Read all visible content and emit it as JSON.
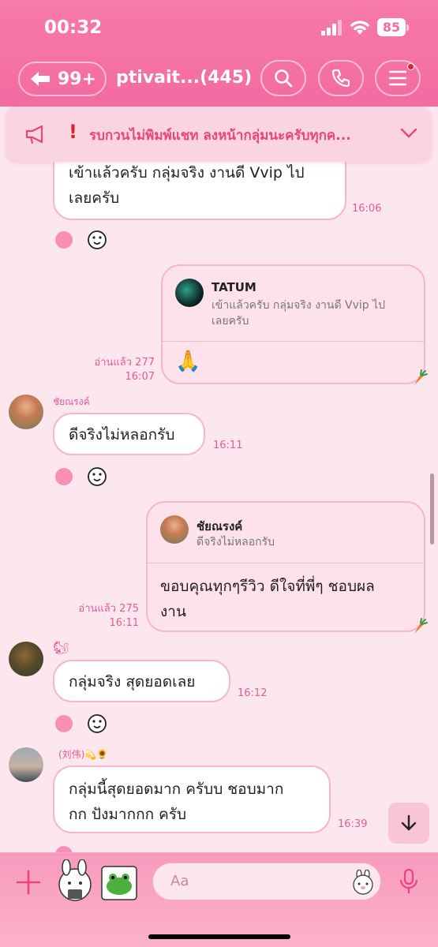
{
  "status_bar": {
    "time": "00:32",
    "battery": "85"
  },
  "header": {
    "unread_count": "99+",
    "chat_title": "ptivait...(445)"
  },
  "announcement": {
    "text": "รบกวนไม่พิมพ์แชท ลงหน้ากลุ่มนะครับทุกค..."
  },
  "messages": [
    {
      "type": "incoming",
      "text_lines": [
        "เข้าแล้วครับ กลุ่มจริง งานดี Vvip ไป",
        "เลยครับ"
      ],
      "time": "16:06"
    },
    {
      "type": "outgoing_reply",
      "quote_name": "TATUM",
      "quote_lines": [
        "เข้าแล้วครับ กลุ่มจริง งานดี Vvip ไป",
        "เลยครับ"
      ],
      "text": "🙏",
      "read": "อ่านแล้ว 277",
      "time": "16:07"
    },
    {
      "type": "incoming",
      "sender": "ชัยณรงค์",
      "text_lines": [
        "ดีจริงไม่หลอกรับ"
      ],
      "time": "16:11"
    },
    {
      "type": "outgoing_reply",
      "quote_name": "ชัยณรงค์",
      "quote_lines": [
        "ดีจริงไม่หลอกรับ"
      ],
      "text_lines": [
        "ขอบคุณทุกๆรีวิว ดีใจที่พี่ๆ ชอบผล",
        "งาน"
      ],
      "read": "อ่านแล้ว 275",
      "time": "16:11"
    },
    {
      "type": "incoming",
      "sender": "🐿",
      "text_lines": [
        "กลุ่มจริง สุดยอดเลย"
      ],
      "time": "16:12"
    },
    {
      "type": "incoming",
      "sender": "(刘伟)💫🌻",
      "text_lines": [
        "กลุ่มนี้สุดยอดมาก ครับบ ชอบมาก",
        "กก ปังมากกก ครับ"
      ],
      "time": "16:39"
    }
  ],
  "composer": {
    "placeholder": "Aa"
  },
  "colors": {
    "accent": "#f36ba0",
    "bubble_border": "#f7b5ce",
    "time_text": "#e65a90"
  },
  "icons": [
    "back-arrow-icon",
    "search-icon",
    "phone-icon",
    "menu-icon",
    "megaphone-icon",
    "chevron-down-icon",
    "smile-icon",
    "scroll-down-icon",
    "plus-icon",
    "microphone-icon"
  ]
}
